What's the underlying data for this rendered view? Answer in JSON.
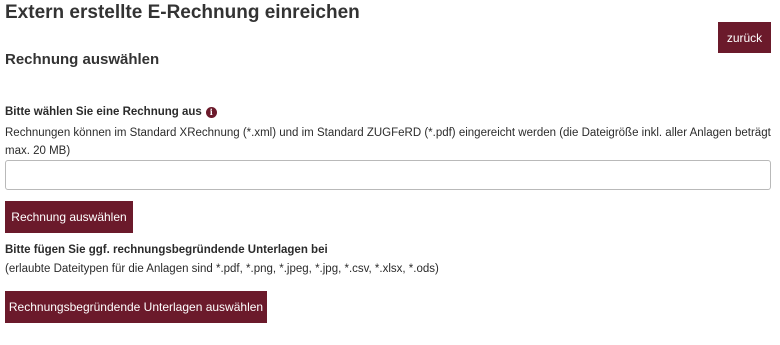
{
  "header": {
    "title": "Extern erstellte E-Rechnung einreichen",
    "back_label": "zurück"
  },
  "section": {
    "title": "Rechnung auswählen"
  },
  "invoice_field": {
    "label": "Bitte wählen Sie eine Rechnung aus",
    "info_icon": "info-icon",
    "info_glyph": "i",
    "help_text": "Rechnungen können im Standard XRechnung (*.xml) und im Standard ZUGFeRD (*.pdf) eingereicht werden (die Dateigröße inkl. aller Anlagen beträgt max. 20 MB)",
    "value": "",
    "button_label": "Rechnung auswählen"
  },
  "attachments": {
    "label": "Bitte fügen Sie ggf. rechnungsbegründende Unterlagen bei",
    "help_text": "(erlaubte Dateitypen für die Anlagen sind *.pdf, *.png, *.jpeg, *.jpg, *.csv, *.xlsx, *.ods)",
    "button_label": "Rechnungsbegründende Unterlagen auswählen"
  },
  "colors": {
    "accent": "#6b1a2b",
    "text": "#2b2b2b",
    "input_border": "#b9b9b9"
  }
}
